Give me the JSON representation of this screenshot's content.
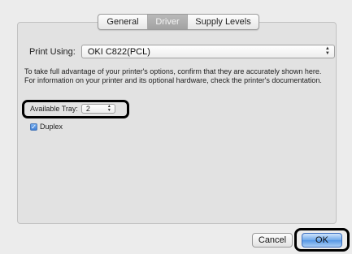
{
  "tabs": [
    {
      "label": "General",
      "selected": false
    },
    {
      "label": "Driver",
      "selected": true
    },
    {
      "label": "Supply Levels",
      "selected": false
    }
  ],
  "print_using": {
    "label": "Print Using:",
    "value": "OKI C822(PCL)"
  },
  "description": "To take full advantage of your printer's options, confirm that they are accurately shown here. For information on your printer and its optional hardware, check the printer's documentation.",
  "available_tray": {
    "label": "Available Tray:",
    "value": "2"
  },
  "duplex": {
    "label": "Duplex",
    "checked": true
  },
  "buttons": {
    "cancel": "Cancel",
    "ok": "OK"
  },
  "colors": {
    "window_bg": "#ececec",
    "panel_bg": "#e2e2e2",
    "selected_tab": "#a8a8a8",
    "default_button": "#5597e6",
    "highlight_outline": "#000000"
  },
  "icons": [
    "updown-arrows-icon",
    "checkmark-icon"
  ]
}
